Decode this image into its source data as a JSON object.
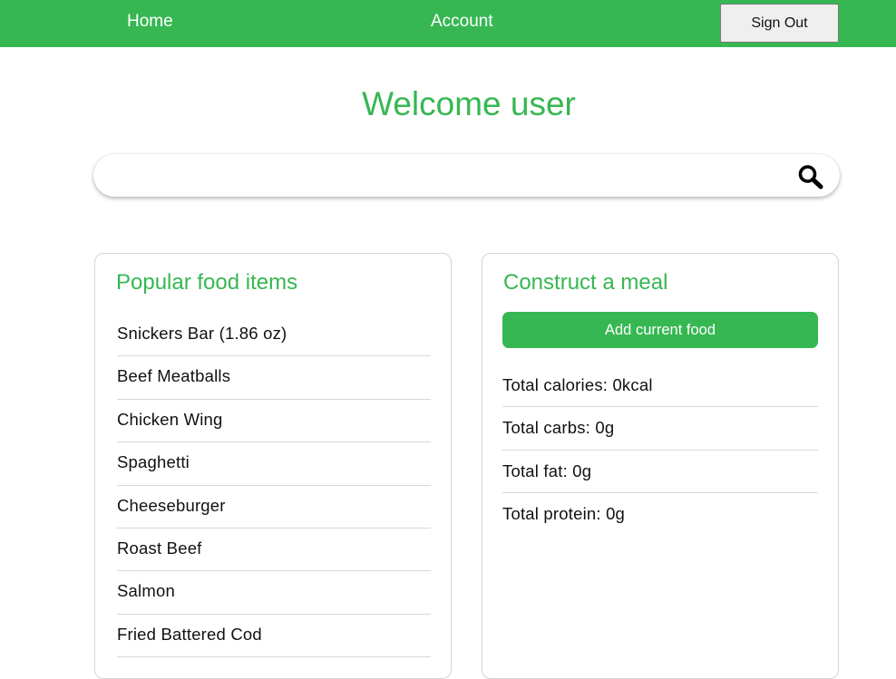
{
  "nav": {
    "home_label": "Home",
    "account_label": "Account",
    "signout_label": "Sign Out",
    "brand_color": "#36b752"
  },
  "welcome": "Welcome user",
  "search": {
    "value": "",
    "placeholder": "",
    "icon": "search-icon"
  },
  "popular": {
    "title": "Popular food items",
    "items": [
      "Snickers Bar (1.86 oz)",
      "Beef Meatballs",
      "Chicken Wing",
      "Spaghetti",
      "Cheeseburger",
      "Roast Beef",
      "Salmon",
      "Fried Battered Cod"
    ]
  },
  "meal": {
    "title": "Construct a meal",
    "add_label": "Add current food",
    "totals": [
      "Total calories: 0kcal",
      "Total carbs: 0g",
      "Total fat: 0g",
      "Total protein: 0g"
    ]
  }
}
